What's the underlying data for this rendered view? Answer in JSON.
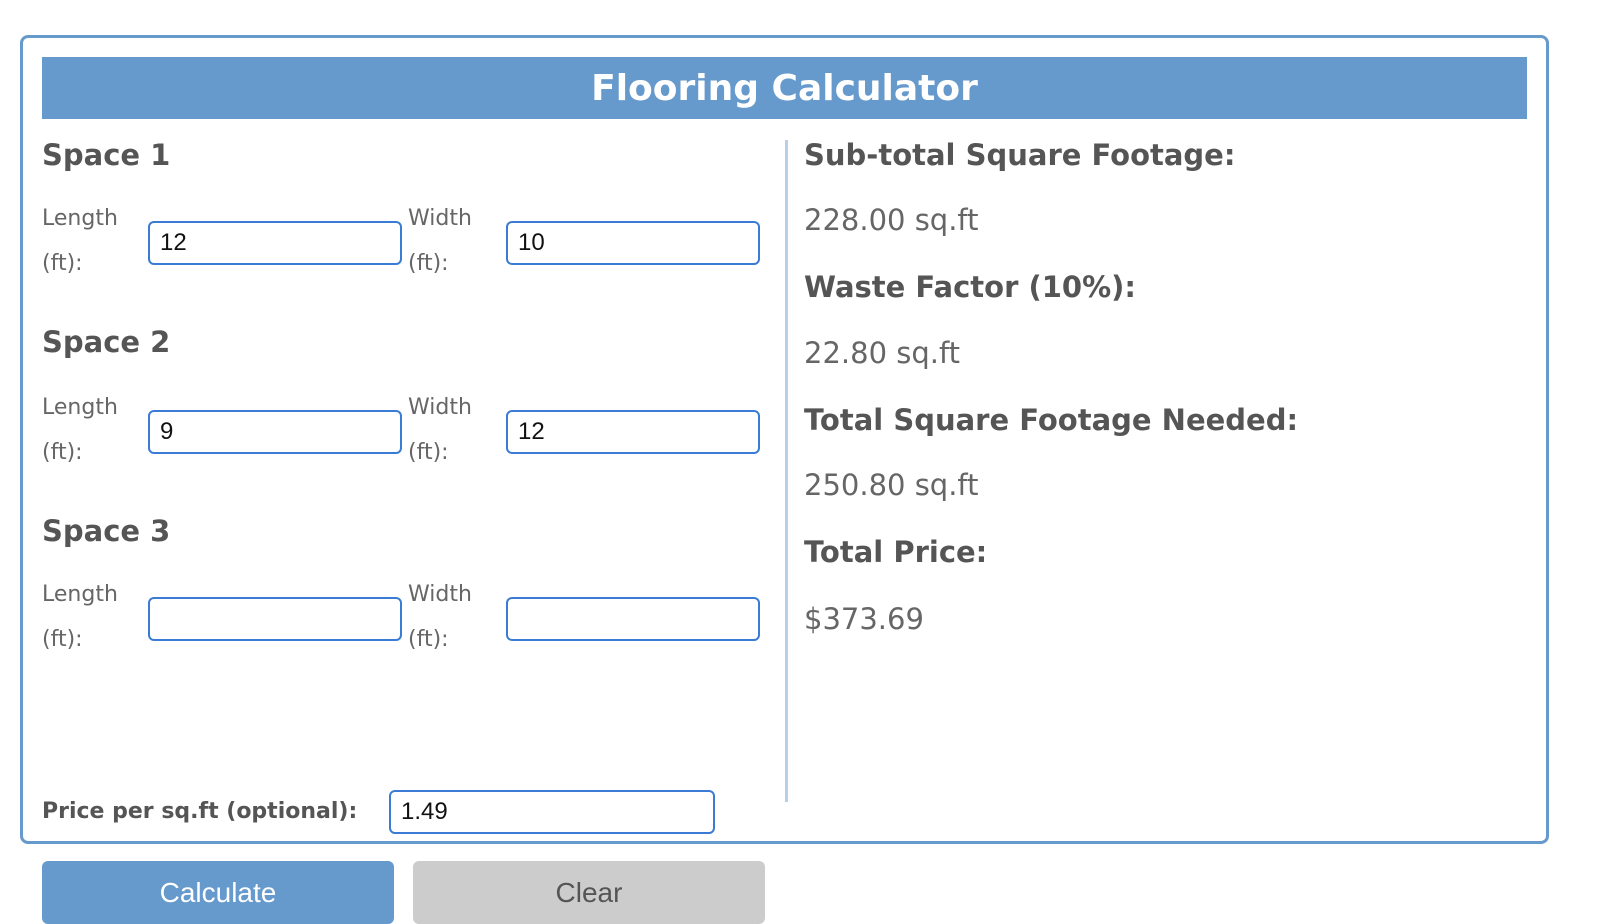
{
  "title": "Flooring Calculator",
  "spaces": [
    {
      "title": "Space 1",
      "length_label": "Length (ft):",
      "width_label": "Width (ft):",
      "length": "12",
      "width": "10"
    },
    {
      "title": "Space 2",
      "length_label": "Length (ft):",
      "width_label": "Width (ft):",
      "length": "9",
      "width": "12"
    },
    {
      "title": "Space 3",
      "length_label": "Length (ft):",
      "width_label": "Width (ft):",
      "length": "",
      "width": ""
    }
  ],
  "price": {
    "label": "Price per sq.ft (optional):",
    "value": "1.49"
  },
  "buttons": {
    "calculate": "Calculate",
    "clear": "Clear"
  },
  "results": [
    {
      "label": "Sub-total Square Footage:",
      "value": "228.00 sq.ft"
    },
    {
      "label": "Waste Factor (10%):",
      "value": "22.80 sq.ft"
    },
    {
      "label": "Total Square Footage Needed:",
      "value": "250.80 sq.ft"
    },
    {
      "label": "Total Price:",
      "value": "$373.69"
    }
  ],
  "colors": {
    "accent": "#6699cc",
    "input_border": "#3a7bd5",
    "clear_button": "#cccccc"
  }
}
